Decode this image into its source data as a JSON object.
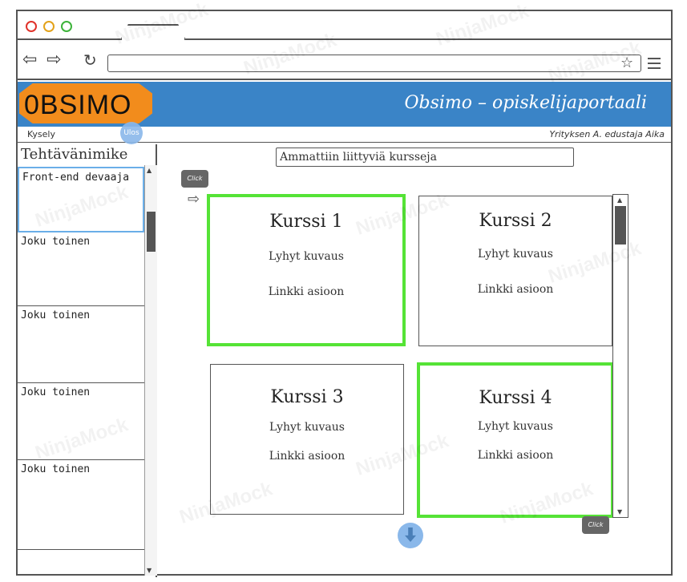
{
  "browser": {
    "dot_colors": [
      "#e0322a",
      "#e3a21a",
      "#3db33a"
    ],
    "tab_label": "",
    "back_icon": "back-arrow-icon",
    "forward_icon": "forward-arrow-icon",
    "reload_icon": "reload-icon",
    "url_value": "",
    "bookmark_icon": "star-icon",
    "menu_icon": "hamburger-menu-icon"
  },
  "header": {
    "logo_text": "0BSIMO",
    "portal_title": "Obsimo – opiskelijaportaali",
    "accent_color": "#3a84c7",
    "logo_color": "#f28c1c"
  },
  "subbar": {
    "kysely": "Kysely",
    "logout": "Ulos",
    "user_info": "Yrityksen A. edustaja  Aika"
  },
  "sidebar": {
    "heading": "Tehtävänimike",
    "items": [
      {
        "label": "Front-end devaaja"
      },
      {
        "label": "Joku toinen"
      },
      {
        "label": "Joku toinen"
      },
      {
        "label": "Joku toinen"
      },
      {
        "label": "Joku toinen"
      }
    ]
  },
  "main": {
    "search_value": "Ammattiin liittyviä kursseja",
    "click_label": "Click",
    "cards": [
      {
        "title": "Kurssi 1",
        "description": "Lyhyt kuvaus",
        "link": "Linkki asioon"
      },
      {
        "title": "Kurssi 2",
        "description": "Lyhyt kuvaus",
        "link": "Linkki asioon"
      },
      {
        "title": "Kurssi 3",
        "description": "Lyhyt kuvaus",
        "link": "Linkki asioon"
      },
      {
        "title": "Kurssi 4",
        "description": "Lyhyt kuvaus",
        "link": "Linkki asioon"
      }
    ],
    "highlight_color": "#55e336"
  },
  "watermark": "NinjaMock"
}
